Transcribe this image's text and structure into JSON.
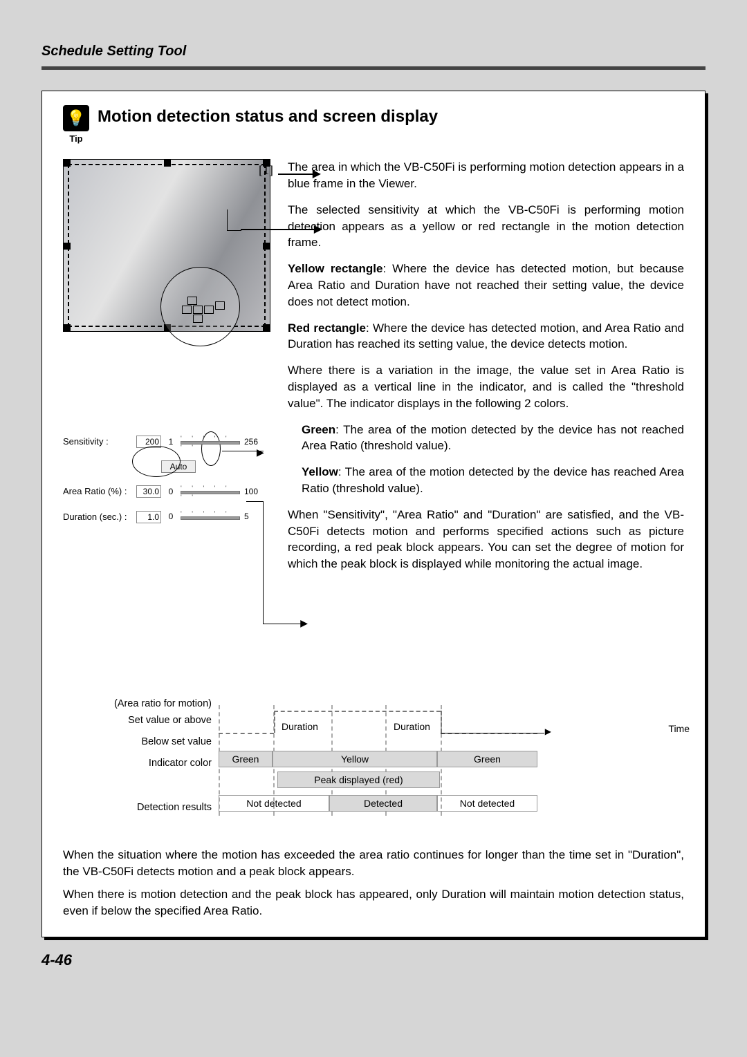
{
  "header": "Schedule Setting Tool",
  "title": "Motion detection status and screen display",
  "tip_label": "Tip",
  "callout_one": "[1]",
  "para1": "The area in which the VB-C50Fi is performing motion detection appears in a blue frame in the Viewer.",
  "para2": "The selected sensitivity at which the VB-C50Fi is performing motion detection appears as a yellow or red rectangle in the motion detection frame.",
  "yellow_label": "Yellow rectangle",
  "yellow_text": ": Where the device has detected motion, but because Area Ratio and Duration have not reached their setting value, the device does not detect motion.",
  "red_label": "Red rectangle",
  "red_text": ": Where the device has detected motion, and Area Ratio and Duration has reached its setting value, the device detects motion.",
  "para3a": "Where there is a variation in the image, the value set in Area Ratio is displayed as a vertical line in the indicator, and is called the \"threshold value\". The indicator displays in the following 2 colors.",
  "green_label": "Green",
  "green_text": ": The area of the motion detected by the device has not reached Area Ratio (threshold value).",
  "yellow2_label": "Yellow",
  "yellow2_text": ": The area of the motion detected by the device has reached Area Ratio (threshold value).",
  "para4": "When \"Sensitivity\", \"Area Ratio\" and \"Duration\" are satisfied, and the VB-C50Fi detects motion and performs specified actions such as picture recording, a red peak block appears. You can set the degree of motion for which the peak block is displayed while monitoring the actual image.",
  "sliders": {
    "sensitivity": {
      "label": "Sensitivity :",
      "value": "200",
      "min": "1",
      "max": "256"
    },
    "auto": "Auto",
    "area_ratio": {
      "label": "Area Ratio (%) :",
      "value": "30.0",
      "min": "0",
      "max": "100"
    },
    "duration": {
      "label": "Duration (sec.) :",
      "value": "1.0",
      "min": "0",
      "max": "5"
    }
  },
  "diagram": {
    "area_ratio": "(Area ratio for motion)",
    "set_above": "Set value or above",
    "below_set": "Below set value",
    "indicator_color": "Indicator color",
    "green": "Green",
    "yellow": "Yellow",
    "peak": "Peak displayed (red)",
    "detection_results": "Detection results",
    "not_detected": "Not detected",
    "detected": "Detected",
    "duration": "Duration",
    "time": "Time"
  },
  "bottom1": "When the situation where the motion has exceeded the area ratio continues for longer than the time set in \"Duration\", the VB-C50Fi detects motion and a peak block appears.",
  "bottom2": "When there is motion detection and the peak block has appeared, only Duration will maintain motion detection status, even if below the specified Area Ratio.",
  "page_number": "4-46"
}
